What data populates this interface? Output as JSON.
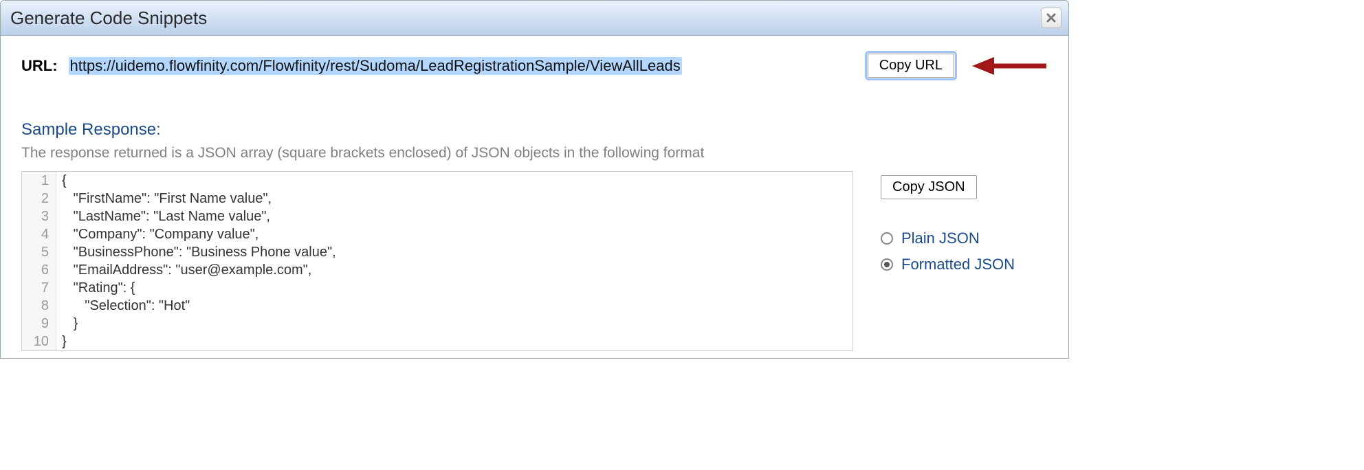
{
  "dialog": {
    "title": "Generate Code Snippets"
  },
  "url": {
    "label": "URL:",
    "value": "https://uidemo.flowfinity.com/Flowfinity/rest/Sudoma/LeadRegistrationSample/ViewAllLeads",
    "copy_button": "Copy URL"
  },
  "sample": {
    "title": "Sample Response:",
    "description": "The response returned is a JSON array (square brackets enclosed) of JSON objects in the following format"
  },
  "code_lines": [
    "{",
    "   \"FirstName\": \"First Name value\",",
    "   \"LastName\": \"Last Name value\",",
    "   \"Company\": \"Company value\",",
    "   \"BusinessPhone\": \"Business Phone value\",",
    "   \"EmailAddress\": \"user@example.com\",",
    "   \"Rating\": {",
    "      \"Selection\": \"Hot\"",
    "   }",
    "}"
  ],
  "side": {
    "copy_json": "Copy JSON",
    "options": [
      {
        "label": "Plain JSON",
        "checked": false
      },
      {
        "label": "Formatted JSON",
        "checked": true
      }
    ]
  }
}
